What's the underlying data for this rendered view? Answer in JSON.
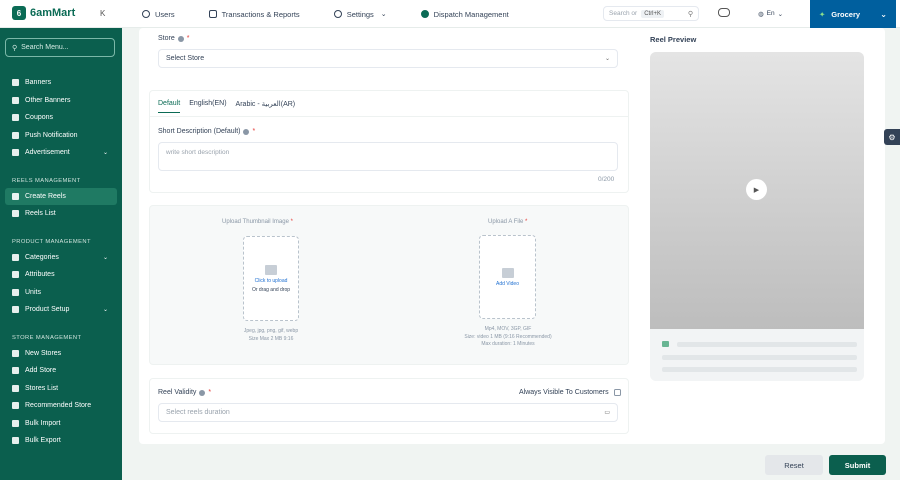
{
  "header": {
    "brand": "6amMart",
    "logo_letter": "6",
    "collapse": "K",
    "nav": [
      {
        "label": "Users"
      },
      {
        "label": "Transactions & Reports"
      },
      {
        "label": "Settings"
      },
      {
        "label": "Dispatch Management"
      }
    ],
    "search": {
      "placeholder": "Search or",
      "shortcut": "Ctrl+K"
    },
    "language": "En",
    "module": "Grocery"
  },
  "sidebar": {
    "search_placeholder": "Search Menu...",
    "items_top": [
      {
        "label": "Banners"
      },
      {
        "label": "Other Banners"
      },
      {
        "label": "Coupons"
      },
      {
        "label": "Push Notification"
      },
      {
        "label": "Advertisement"
      }
    ],
    "section_reels": "REELS MANAGEMENT",
    "items_reels": [
      {
        "label": "Create Reels"
      },
      {
        "label": "Reels List"
      }
    ],
    "section_product": "PRODUCT MANAGEMENT",
    "items_product": [
      {
        "label": "Categories"
      },
      {
        "label": "Attributes"
      },
      {
        "label": "Units"
      },
      {
        "label": "Product Setup"
      }
    ],
    "section_store": "STORE MANAGEMENT",
    "items_store": [
      {
        "label": "New Stores"
      },
      {
        "label": "Add Store"
      },
      {
        "label": "Stores List"
      },
      {
        "label": "Recommended Store"
      },
      {
        "label": "Bulk Import"
      },
      {
        "label": "Bulk Export"
      }
    ]
  },
  "form": {
    "store_label": "Store",
    "store_value": "Select Store",
    "tabs": [
      {
        "label": "Default"
      },
      {
        "label": "English(EN)"
      },
      {
        "label": "Arabic - العربية(AR)"
      }
    ],
    "short_desc_label": "Short Description (Default)",
    "short_desc_placeholder": "write short description",
    "char_count": "0/200",
    "thumbnail": {
      "title": "Upload Thumbnail Image",
      "link": "Click to upload",
      "sub": "Or drag and drop",
      "note1": "Jpeg, jpg, png, gif, webp",
      "note2": "Size Max 2 MB 9:16"
    },
    "file": {
      "title": "Upload A File",
      "link": "Add Video",
      "note1": "Mp4, MOV, 3GP, GIF",
      "note2": "Size: video 1 MB (9:16 Recommended)",
      "note3": "Max duration: 1 Minutes"
    },
    "validity_label": "Reel Validity",
    "validity_placeholder": "Select reels duration",
    "always_visible": "Always Visible To Customers",
    "required_mark": "*"
  },
  "preview": {
    "title": "Reel Preview"
  },
  "actions": {
    "reset": "Reset",
    "submit": "Submit"
  }
}
